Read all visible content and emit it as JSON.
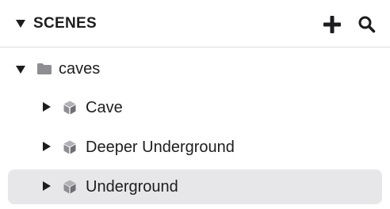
{
  "header": {
    "title": "SCENES",
    "collapse_icon": "disclosure-down-icon",
    "add_icon": "plus-icon",
    "search_icon": "magnifier-icon"
  },
  "tree": {
    "folder": {
      "label": "caves",
      "expanded": true,
      "icon": "folder-icon"
    },
    "items": [
      {
        "label": "Cave",
        "icon": "cube-icon",
        "selected": false
      },
      {
        "label": "Deeper Underground",
        "icon": "cube-icon",
        "selected": false
      },
      {
        "label": "Underground",
        "icon": "cube-icon",
        "selected": true
      }
    ]
  },
  "colors": {
    "text": "#1d1d1f",
    "icon_gray": "#8e8e93",
    "selected_bg": "#e7e7e9",
    "divider": "#dcdcdc"
  }
}
